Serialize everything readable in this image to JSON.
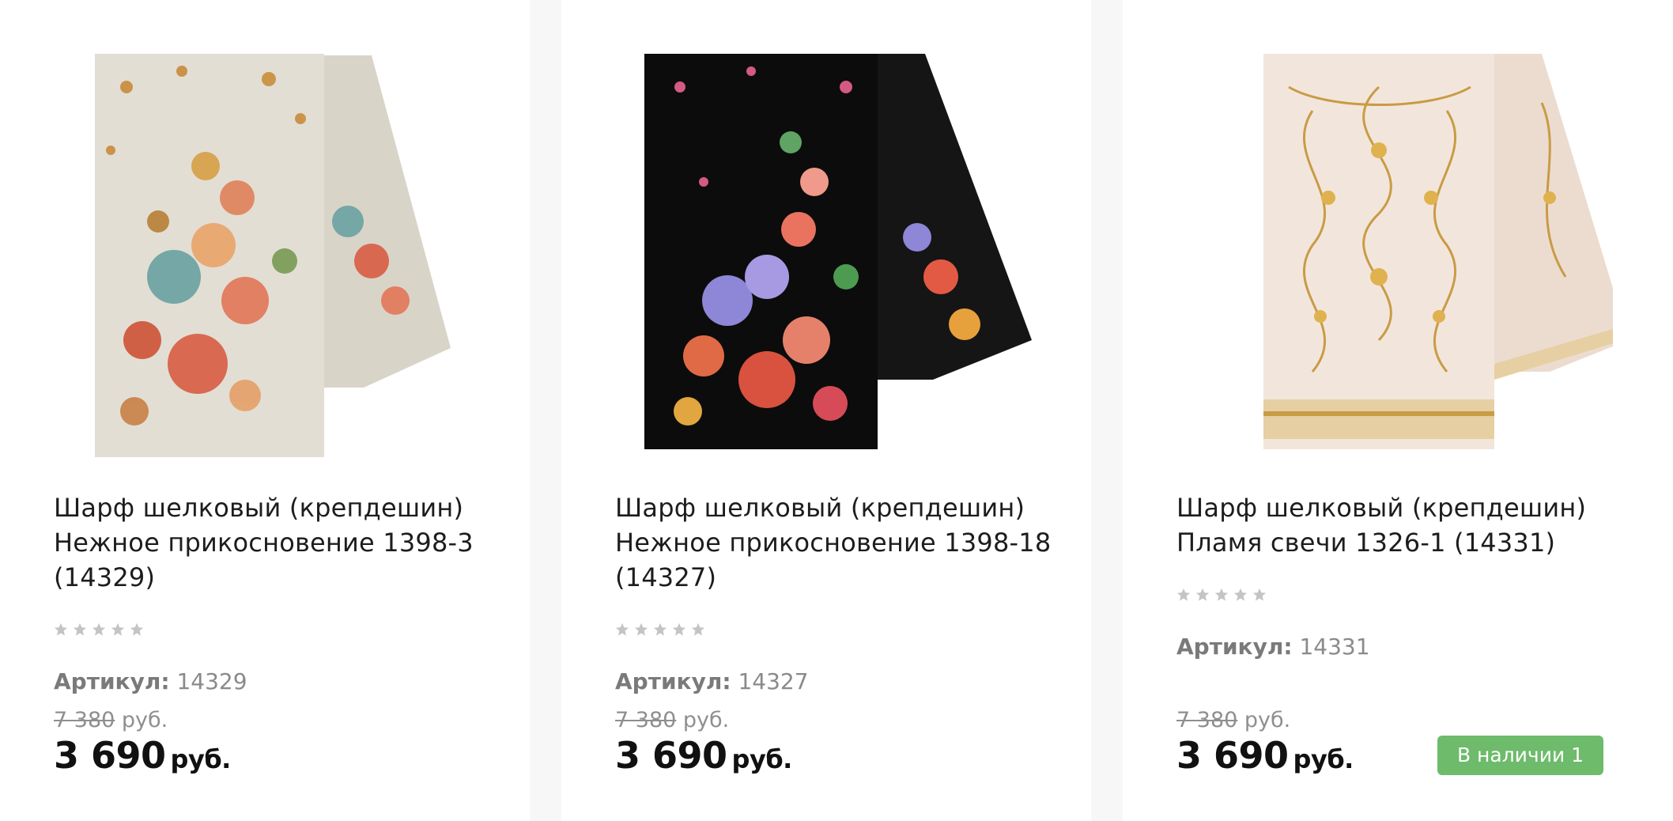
{
  "currency": "руб.",
  "products": [
    {
      "title_line1": "Шарф шелковый (крепдешин)",
      "title_line2": "Нежное прикосновение 1398-3",
      "title_line3": "(14329)",
      "rating": 0,
      "sku_label": "Артикул:",
      "sku": "14329",
      "old_price": "7 380",
      "price": "3 690",
      "image": "scarf-cream-floral"
    },
    {
      "title_line1": "Шарф шелковый (крепдешин)",
      "title_line2": "Нежное прикосновение 1398-18",
      "title_line3": "(14327)",
      "rating": 0,
      "sku_label": "Артикул:",
      "sku": "14327",
      "old_price": "7 380",
      "price": "3 690",
      "image": "scarf-black-floral"
    },
    {
      "title_line1": "Шарф шелковый (крепдешин)",
      "title_line2": "Пламя свечи 1326-1 (14331)",
      "rating": 0,
      "sku_label": "Артикул:",
      "sku": "14331",
      "old_price": "7 380",
      "price": "3 690",
      "stock_badge": "В наличии 1",
      "image": "scarf-beige-ornament"
    }
  ],
  "colors": {
    "stock_green": "#6dbb6b",
    "muted_text": "#8a8a8a",
    "star_grey": "#c4c4c4"
  }
}
